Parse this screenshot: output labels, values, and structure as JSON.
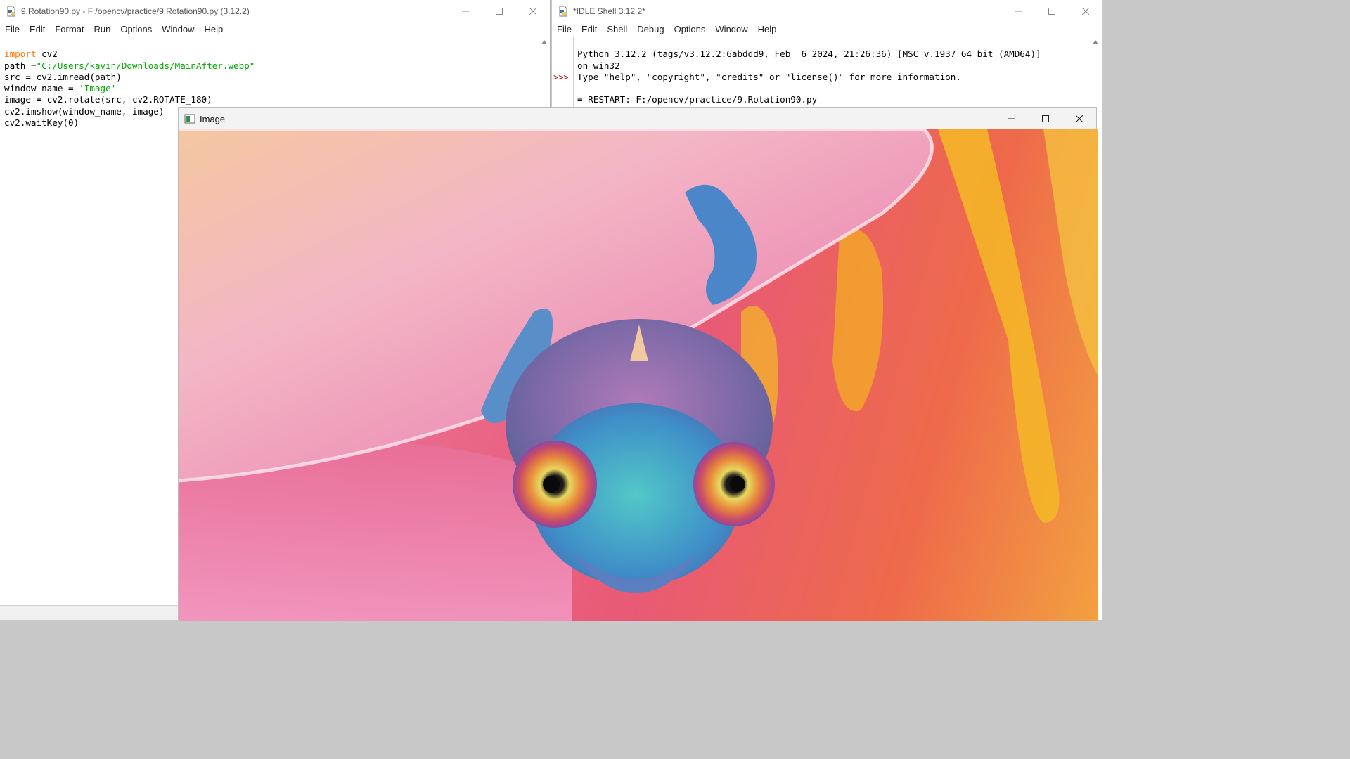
{
  "editor": {
    "title": "9.Rotation90.py - F:/opencv/practice/9.Rotation90.py (3.12.2)",
    "menu": [
      "File",
      "Edit",
      "Format",
      "Run",
      "Options",
      "Window",
      "Help"
    ],
    "code": [
      {
        "kw": "import",
        "rest": " cv2"
      },
      {
        "pre": "path =",
        "str": "\"C:/Users/kavin/Downloads/MainAfter.webp\""
      },
      {
        "pre": "src = cv2.imread(path)"
      },
      {
        "pre": "window_name = ",
        "str": "'Image'"
      },
      {
        "pre": "image = cv2.rotate(src, cv2.ROTATE_180)"
      },
      {
        "pre": "cv2.imshow(window_name, image)"
      },
      {
        "pre": "cv2.waitKey(0)"
      }
    ]
  },
  "shell": {
    "title": "*IDLE Shell 3.12.2*",
    "menu": [
      "File",
      "Edit",
      "Shell",
      "Debug",
      "Options",
      "Window",
      "Help"
    ],
    "lines": [
      "Python 3.12.2 (tags/v3.12.2:6abddd9, Feb  6 2024, 21:26:36) [MSC v.1937 64 bit (AMD64)]",
      "on win32",
      "Type \"help\", \"copyright\", \"credits\" or \"license()\" for more information.",
      "",
      "= RESTART: F:/opencv/practice/9.Rotation90.py"
    ],
    "prompt": ">>>"
  },
  "image_window": {
    "title": "Image",
    "content": "upside-down chameleon on pink flower petals"
  },
  "colors": {
    "keyword": "#ff7700",
    "string": "#00aa00",
    "prompt": "#c00000"
  },
  "icons": {
    "editor": "python-file-icon",
    "shell": "python-shell-icon",
    "image": "opencv-window-icon",
    "minimize": "minimize-icon",
    "maximize": "maximize-icon",
    "close": "close-icon"
  }
}
